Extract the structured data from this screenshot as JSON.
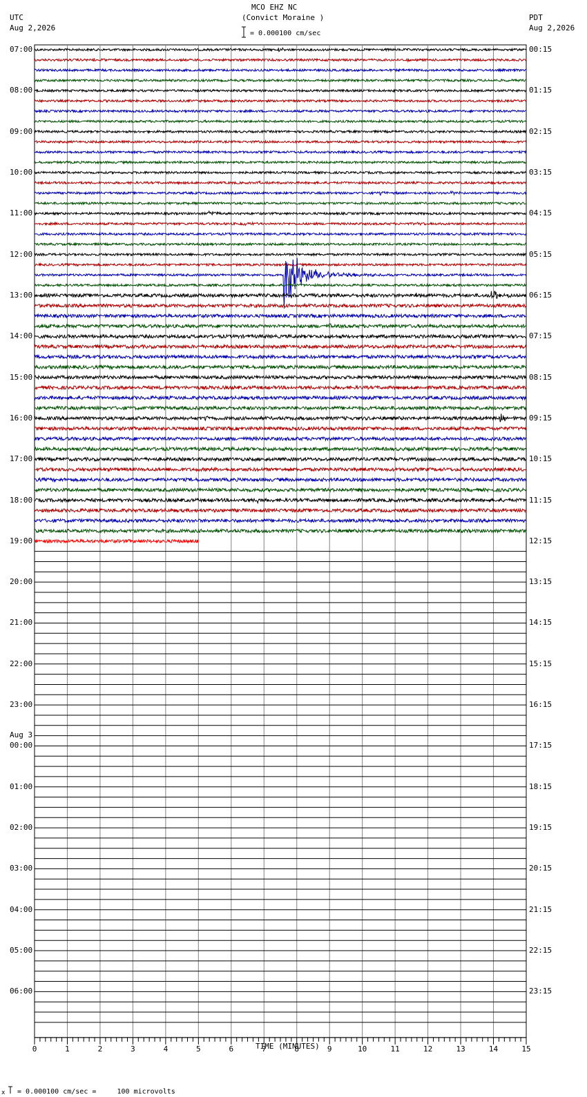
{
  "header": {
    "station": "MCO EHZ NC",
    "location": "(Convict Moraine )",
    "left_zone": "UTC",
    "left_date": "Aug 2,2026",
    "right_zone": "PDT",
    "right_date": "Aug 2,2026",
    "scale_text": "= 0.000100 cm/sec"
  },
  "footer": {
    "scale_prefix": "x",
    "scale_text": "= 0.000100 cm/sec =     100 microvolts"
  },
  "colors": {
    "trace_cycle": [
      "#000000",
      "#b00000",
      "#0000b0",
      "#005000"
    ],
    "current_trace": "#ff0000",
    "grid": "#000000"
  },
  "chart_data": {
    "type": "line",
    "xlabel": "TIME (MINUTES)",
    "xlim": [
      0,
      15
    ],
    "x_ticks": [
      "0",
      "1",
      "2",
      "3",
      "4",
      "5",
      "6",
      "7",
      "8",
      "9",
      "10",
      "11",
      "12",
      "13",
      "14",
      "15"
    ],
    "rows_total": 96,
    "rows_recorded": 48,
    "current_row_minutes_recorded": 5,
    "left_labels": [
      {
        "row": 0,
        "text": "07:00"
      },
      {
        "row": 4,
        "text": "08:00"
      },
      {
        "row": 8,
        "text": "09:00"
      },
      {
        "row": 12,
        "text": "10:00"
      },
      {
        "row": 16,
        "text": "11:00"
      },
      {
        "row": 20,
        "text": "12:00"
      },
      {
        "row": 24,
        "text": "13:00"
      },
      {
        "row": 28,
        "text": "14:00"
      },
      {
        "row": 32,
        "text": "15:00"
      },
      {
        "row": 36,
        "text": "16:00"
      },
      {
        "row": 40,
        "text": "17:00"
      },
      {
        "row": 44,
        "text": "18:00"
      },
      {
        "row": 48,
        "text": "19:00"
      },
      {
        "row": 52,
        "text": "20:00"
      },
      {
        "row": 56,
        "text": "21:00"
      },
      {
        "row": 60,
        "text": "22:00"
      },
      {
        "row": 64,
        "text": "23:00"
      },
      {
        "row": 68,
        "text": "00:00",
        "date": "Aug 3"
      },
      {
        "row": 72,
        "text": "01:00"
      },
      {
        "row": 76,
        "text": "02:00"
      },
      {
        "row": 80,
        "text": "03:00"
      },
      {
        "row": 84,
        "text": "04:00"
      },
      {
        "row": 88,
        "text": "05:00"
      },
      {
        "row": 92,
        "text": "06:00"
      }
    ],
    "right_labels": [
      {
        "row": 0,
        "text": "00:15"
      },
      {
        "row": 4,
        "text": "01:15"
      },
      {
        "row": 8,
        "text": "02:15"
      },
      {
        "row": 12,
        "text": "03:15"
      },
      {
        "row": 16,
        "text": "04:15"
      },
      {
        "row": 20,
        "text": "05:15"
      },
      {
        "row": 24,
        "text": "06:15"
      },
      {
        "row": 28,
        "text": "07:15"
      },
      {
        "row": 32,
        "text": "08:15"
      },
      {
        "row": 36,
        "text": "09:15"
      },
      {
        "row": 40,
        "text": "10:15"
      },
      {
        "row": 44,
        "text": "11:15"
      },
      {
        "row": 48,
        "text": "12:15"
      },
      {
        "row": 52,
        "text": "13:15"
      },
      {
        "row": 56,
        "text": "14:15"
      },
      {
        "row": 60,
        "text": "15:15"
      },
      {
        "row": 64,
        "text": "16:15"
      },
      {
        "row": 68,
        "text": "17:15"
      },
      {
        "row": 72,
        "text": "18:15"
      },
      {
        "row": 76,
        "text": "19:15"
      },
      {
        "row": 80,
        "text": "20:15"
      },
      {
        "row": 84,
        "text": "21:15"
      },
      {
        "row": 88,
        "text": "22:15"
      },
      {
        "row": 92,
        "text": "23:15"
      }
    ],
    "noise_by_row": [
      2,
      2,
      2,
      2,
      2,
      2,
      2,
      2,
      2,
      2,
      2,
      2,
      2,
      2,
      2,
      2,
      2,
      2,
      2,
      2,
      2,
      2,
      2,
      2,
      3,
      3,
      3,
      3,
      3,
      3,
      3,
      3,
      3,
      3,
      3,
      3,
      3,
      3,
      3,
      3,
      3,
      3,
      3,
      3,
      3,
      3,
      3,
      3,
      3
    ],
    "events": [
      {
        "row": 0,
        "minute": 7.4,
        "amplitude": 4,
        "duration": 0.5
      },
      {
        "row": 0,
        "minute": 14.0,
        "amplitude": 4,
        "duration": 0.5
      },
      {
        "row": 1,
        "minute": 1.8,
        "amplitude": 3,
        "duration": 0.4
      },
      {
        "row": 1,
        "minute": 11.3,
        "amplitude": 3,
        "duration": 0.5
      },
      {
        "row": 12,
        "minute": 7.0,
        "amplitude": 4,
        "duration": 0.1
      },
      {
        "row": 13,
        "minute": 6.8,
        "amplitude": 3,
        "duration": 0.4
      },
      {
        "row": 14,
        "minute": 10.5,
        "amplitude": 3,
        "duration": 1.0
      },
      {
        "row": 14,
        "minute": 12.7,
        "amplitude": 5,
        "duration": 0.4
      },
      {
        "row": 15,
        "minute": 4.6,
        "amplitude": 4,
        "duration": 0.4
      },
      {
        "row": 16,
        "minute": 5.3,
        "amplitude": 6,
        "duration": 0.8
      },
      {
        "row": 17,
        "minute": 6.3,
        "amplitude": 3,
        "duration": 0.8
      },
      {
        "row": 17,
        "minute": 11.6,
        "amplitude": 3,
        "duration": 0.5
      },
      {
        "row": 19,
        "minute": 4.2,
        "amplitude": 4,
        "duration": 0.5
      },
      {
        "row": 22,
        "minute": 7.6,
        "amplitude": 68,
        "duration": 1.4
      },
      {
        "row": 22,
        "minute": 8.9,
        "amplitude": 5,
        "duration": 2.5
      },
      {
        "row": 24,
        "minute": 7.6,
        "amplitude": 5,
        "duration": 1.2
      },
      {
        "row": 24,
        "minute": 11.6,
        "amplitude": 4,
        "duration": 0.6
      },
      {
        "row": 24,
        "minute": 13.9,
        "amplitude": 9,
        "duration": 1.0
      },
      {
        "row": 27,
        "minute": 9.0,
        "amplitude": 4,
        "duration": 0.4
      },
      {
        "row": 36,
        "minute": 5.2,
        "amplitude": 5,
        "duration": 0.4
      },
      {
        "row": 36,
        "minute": 14.2,
        "amplitude": 7,
        "duration": 0.6
      },
      {
        "row": 44,
        "minute": 6.8,
        "amplitude": 6,
        "duration": 0.2
      }
    ]
  }
}
